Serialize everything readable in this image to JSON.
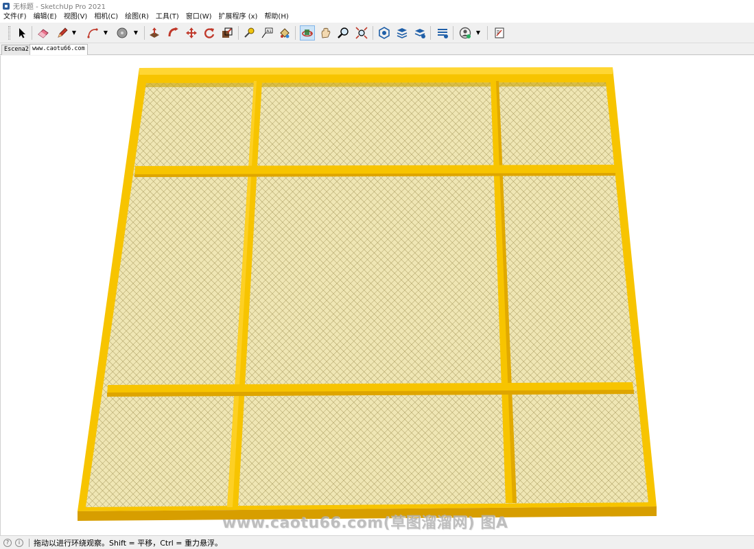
{
  "window": {
    "title": "无标题 - SketchUp Pro 2021"
  },
  "menu": [
    "文件(F)",
    "编辑(E)",
    "视图(V)",
    "相机(C)",
    "绘图(R)",
    "工具(T)",
    "窗口(W)",
    "扩展程序 (x)",
    "帮助(H)"
  ],
  "toolbar": {
    "icons": [
      "select-arrow-icon",
      "eraser-icon",
      "pencil-line-icon",
      "arc-icon",
      "circle-shape-icon",
      "push-pull-icon",
      "follow-me-icon",
      "move-icon",
      "rotate-icon",
      "scale-icon",
      "tape-measure-icon",
      "text-label-icon",
      "paint-bucket-icon",
      "orbit-icon",
      "pan-icon",
      "zoom-icon",
      "zoom-extents-icon",
      "3d-warehouse-icon",
      "extension-warehouse-icon",
      "layout-icon",
      "extension-manager-icon",
      "user-profile-icon",
      "send-to-layout-icon"
    ],
    "active_tool": "orbit-icon"
  },
  "scenes": {
    "tabs": [
      "Escena2",
      "www.caotu66.com"
    ],
    "active": 1
  },
  "watermark": "www.caotu66.com(草图溜溜网) 图A",
  "status": {
    "message": "拖动以进行环绕观察。Shift = 平移，Ctrl = 重力悬浮。"
  },
  "colors": {
    "frame_yellow": "#f7c400",
    "mesh_fill": "#efe6b4",
    "mesh_line": "#a89a5e",
    "active_tool_bg": "#cde4f7"
  }
}
